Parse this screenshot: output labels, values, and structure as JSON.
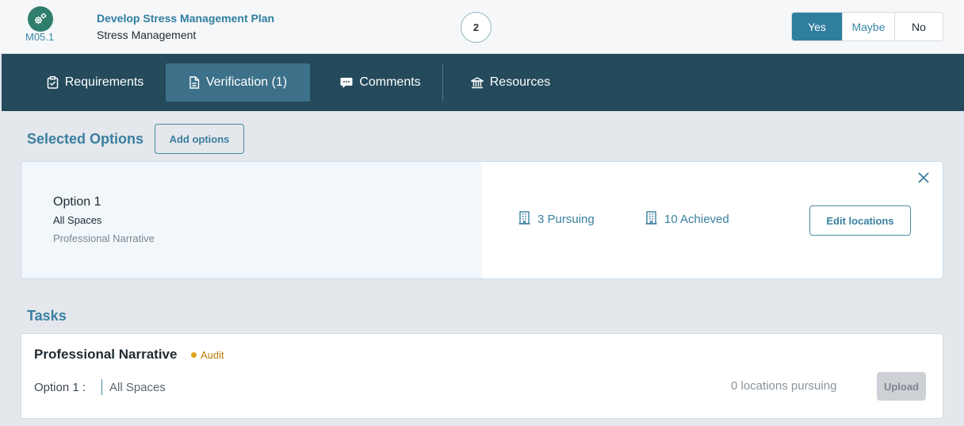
{
  "header": {
    "feature_code": "M05.1",
    "feature_title": "Develop Stress Management Plan",
    "feature_subtitle": "Stress Management",
    "step_number": "2",
    "answers": {
      "yes": "Yes",
      "maybe": "Maybe",
      "no": "No",
      "selected": "Yes"
    }
  },
  "nav": {
    "tabs": [
      {
        "label": "Requirements",
        "icon": "clipboard-check-icon"
      },
      {
        "label": "Verification (1)",
        "icon": "document-icon",
        "active": true
      },
      {
        "label": "Comments",
        "icon": "comment-icon"
      },
      {
        "label": "Resources",
        "icon": "bank-icon"
      }
    ]
  },
  "selected_options": {
    "title": "Selected Options",
    "add_button": "Add options",
    "option": {
      "name": "Option 1",
      "scope": "All Spaces",
      "narrative": "Professional Narrative",
      "pursuing": "3 Pursuing",
      "achieved": "10 Achieved",
      "edit_button": "Edit locations"
    }
  },
  "tasks": {
    "title": "Tasks",
    "task": {
      "title": "Professional Narrative",
      "badge": "Audit",
      "option_label": "Option 1 :",
      "scope": "All Spaces",
      "locations": "0 locations pursuing",
      "upload_button": "Upload"
    }
  },
  "colors": {
    "nav_bg": "#244a5c",
    "nav_active": "#3d7189",
    "accent": "#2f7ea0",
    "badge": "#e0a21a"
  }
}
